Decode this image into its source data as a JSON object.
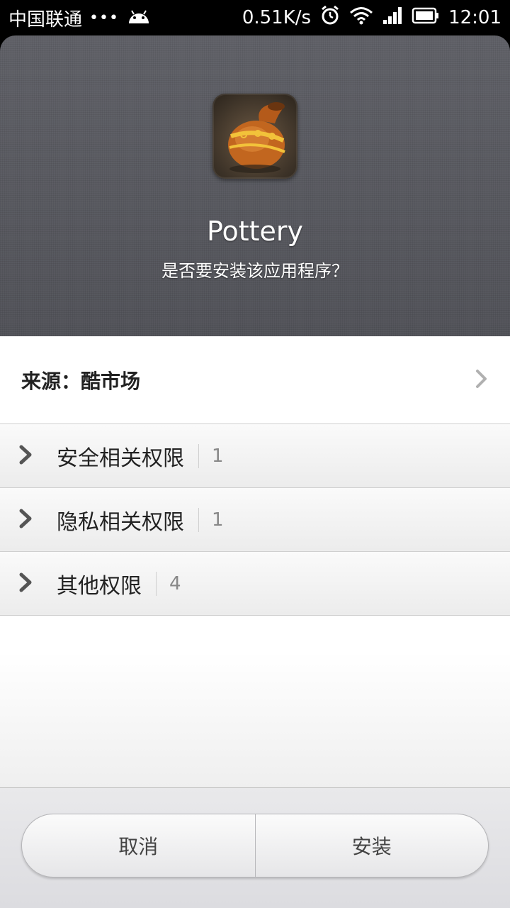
{
  "status_bar": {
    "carrier": "中国联通",
    "dots": "•••",
    "net_speed": "0.51K/s",
    "time": "12:01",
    "icons": [
      "android-icon",
      "alarm-icon",
      "wifi-icon",
      "signal-icon",
      "battery-icon"
    ]
  },
  "app": {
    "name": "Pottery",
    "question": "是否要安装该应用程序？",
    "icon": "pottery-vase-icon"
  },
  "source": {
    "label": "来源：酷市场"
  },
  "permissions": [
    {
      "label": "安全相关权限",
      "count": "1"
    },
    {
      "label": "隐私相关权限",
      "count": "1"
    },
    {
      "label": "其他权限",
      "count": "4"
    }
  ],
  "buttons": {
    "cancel": "取消",
    "install": "安装"
  },
  "colors": {
    "header_bg": "#5c5d64",
    "text_dark": "#222222",
    "count_gray": "#888888"
  }
}
